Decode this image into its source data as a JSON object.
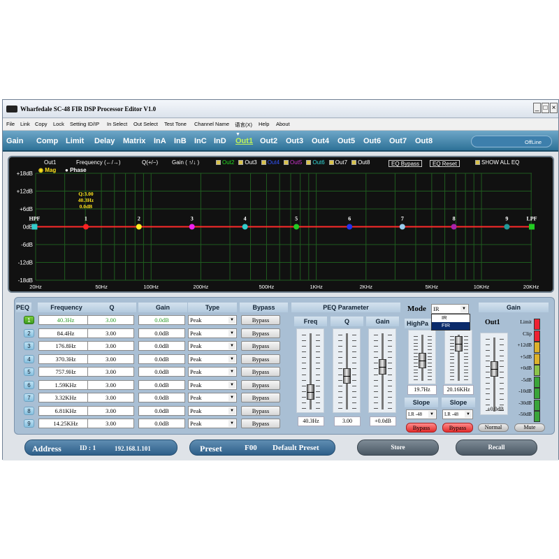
{
  "window": {
    "title": "Wharfedale SC-48 FIR DSP Processor Editor V1.0",
    "min": "_",
    "max": "□",
    "close": "×"
  },
  "menu": [
    "File",
    "Link",
    "Copy",
    "Lock",
    "Setting ID/IP",
    "In Select",
    "Out Select",
    "Test Tone",
    "Channel Name",
    "语言(X)",
    "Help",
    "About"
  ],
  "tabs": [
    "Gain",
    "Comp",
    "Limit",
    "Delay",
    "Matrix",
    "InA",
    "InB",
    "InC",
    "InD",
    "Out1",
    "Out2",
    "Out3",
    "Out4",
    "Out5",
    "Out6",
    "Out7",
    "Out8"
  ],
  "active_tab": "Out1",
  "status": "OffLine",
  "graph": {
    "channel": "Out1",
    "freq_hint": "Frequency  (←/→)",
    "q_hint": "Q(+/−)",
    "gain_hint": "Gain ( ↑/↓ )",
    "outs": [
      "Out2",
      "Out3",
      "Out4",
      "Out5",
      "Out6",
      "Out7",
      "Out8"
    ],
    "out_colors": [
      "#22dd22",
      "#ffffff",
      "#3355ff",
      "#cc33cc",
      "#33dddd",
      "#ffffff",
      "#ffffff"
    ],
    "eq_bypass": "EQ Bypass",
    "eq_reset": "EQ Reset",
    "show_all": "SHOW ALL EQ",
    "mag": "Mag",
    "phase": "Phase",
    "y_labels": [
      "+18dB",
      "+12dB",
      "+6dB",
      "0dB",
      "-6dB",
      "-12dB",
      "-18dB"
    ],
    "x_labels": [
      "20Hz",
      "50Hz",
      "100Hz",
      "200Hz",
      "500Hz",
      "1KHz",
      "2KHz",
      "5KHz",
      "10KHz",
      "20KHz"
    ],
    "x_values": [
      20,
      50,
      100,
      200,
      500,
      1000,
      2000,
      5000,
      10000,
      20000
    ],
    "readout": [
      "Q:3.00",
      "40.3Hz",
      "0.0dB"
    ],
    "points": [
      {
        "label": "HPF",
        "freq": 19.7,
        "color": "#33cccc",
        "shape": "square"
      },
      {
        "label": "1",
        "freq": 40.3,
        "color": "#ff2222",
        "shape": "circle"
      },
      {
        "label": "2",
        "freq": 84.4,
        "color": "#ffee22",
        "shape": "circle"
      },
      {
        "label": "3",
        "freq": 176.8,
        "color": "#ee22ee",
        "shape": "circle"
      },
      {
        "label": "4",
        "freq": 370.3,
        "color": "#33cccc",
        "shape": "circle"
      },
      {
        "label": "5",
        "freq": 757.9,
        "color": "#22cc22",
        "shape": "circle"
      },
      {
        "label": "6",
        "freq": 1590,
        "color": "#2233ee",
        "shape": "circle"
      },
      {
        "label": "7",
        "freq": 3320,
        "color": "#99ccee",
        "shape": "circle"
      },
      {
        "label": "8",
        "freq": 6810,
        "color": "#aa22aa",
        "shape": "circle"
      },
      {
        "label": "9",
        "freq": 14250,
        "color": "#229999",
        "shape": "circle"
      },
      {
        "label": "LPF",
        "freq": 20160,
        "color": "#22cc22",
        "shape": "square"
      }
    ]
  },
  "peq": {
    "headers": {
      "peq": "PEQ",
      "freq": "Frequency",
      "q": "Q",
      "gain": "Gain",
      "type": "Type",
      "bypass": "Bypass"
    },
    "rows": [
      {
        "n": "1",
        "freq": "40.3Hz",
        "q": "3.00",
        "gain": "0.0dB",
        "type": "Peak",
        "bypass": "Bypass"
      },
      {
        "n": "2",
        "freq": "84.4Hz",
        "q": "3.00",
        "gain": "0.0dB",
        "type": "Peak",
        "bypass": "Bypass"
      },
      {
        "n": "3",
        "freq": "176.8Hz",
        "q": "3.00",
        "gain": "0.0dB",
        "type": "Peak",
        "bypass": "Bypass"
      },
      {
        "n": "4",
        "freq": "370.3Hz",
        "q": "3.00",
        "gain": "0.0dB",
        "type": "Peak",
        "bypass": "Bypass"
      },
      {
        "n": "5",
        "freq": "757.9Hz",
        "q": "3.00",
        "gain": "0.0dB",
        "type": "Peak",
        "bypass": "Bypass"
      },
      {
        "n": "6",
        "freq": "1.59KHz",
        "q": "3.00",
        "gain": "0.0dB",
        "type": "Peak",
        "bypass": "Bypass"
      },
      {
        "n": "7",
        "freq": "3.32KHz",
        "q": "3.00",
        "gain": "0.0dB",
        "type": "Peak",
        "bypass": "Bypass"
      },
      {
        "n": "8",
        "freq": "6.81KHz",
        "q": "3.00",
        "gain": "0.0dB",
        "type": "Peak",
        "bypass": "Bypass"
      },
      {
        "n": "9",
        "freq": "14.25KHz",
        "q": "3.00",
        "gain": "0.0dB",
        "type": "Peak",
        "bypass": "Bypass"
      }
    ]
  },
  "peq_param": {
    "title": "PEQ Parameter",
    "freq_label": "Freq",
    "q_label": "Q",
    "gain_label": "Gain",
    "freq_val": "40.3Hz",
    "q_val": "3.00",
    "gain_val": "+0.0dB"
  },
  "mode": {
    "label": "Mode",
    "value": "IR",
    "options": [
      "IR",
      "FIR"
    ]
  },
  "highpass": {
    "label": "HighPa",
    "value": "19.7Hz",
    "slope_label": "Slope",
    "slope": "LR -48",
    "bypass": "Bypass"
  },
  "lowpass": {
    "value": "20.16KHz",
    "slope_label": "Slope",
    "slope": "LR -48",
    "bypass": "Bypass"
  },
  "gain": {
    "title": "Gain",
    "out_label": "Out1",
    "value": "+0.0dB",
    "normal": "Normal",
    "mute": "Mute",
    "meter_labels": [
      "Limit",
      "Clip",
      "+12dB",
      "+5dB",
      "+0dB",
      "-5dB",
      "-10dB",
      "-30dB",
      "-50dB"
    ]
  },
  "footer": {
    "address": "Address",
    "id": "ID : 1",
    "ip": "192.168.1.101",
    "preset": "Preset",
    "preset_num": "F00",
    "preset_name": "Default Preset",
    "store": "Store",
    "recall": "Recall"
  }
}
